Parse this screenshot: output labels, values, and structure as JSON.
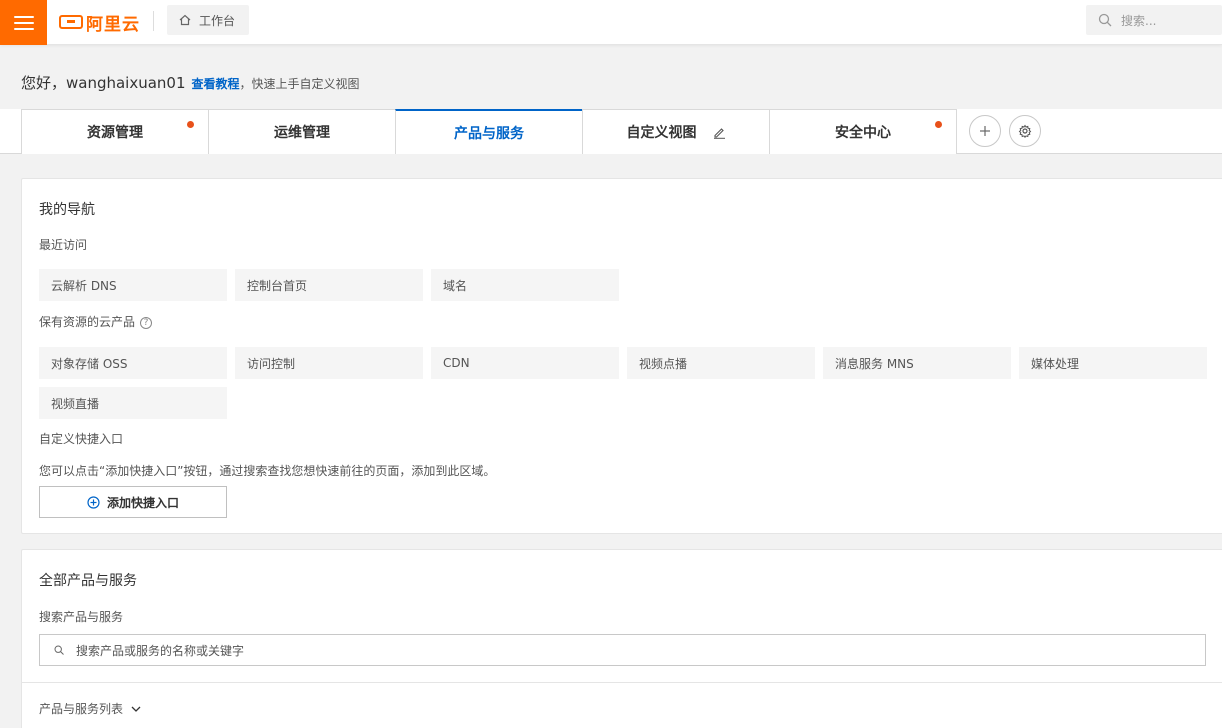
{
  "topbar": {
    "logo_text": "阿里云",
    "workbench_label": "工作台",
    "search_placeholder": "搜索..."
  },
  "greeting": {
    "hello": "您好，wanghaixuan01",
    "tutorial_link": "查看教程",
    "tip": "，快速上手自定义视图"
  },
  "tabs": [
    {
      "label": "资源管理",
      "dot": true
    },
    {
      "label": "运维管理",
      "dot": false
    },
    {
      "label": "产品与服务",
      "active": true
    },
    {
      "label": "自定义视图",
      "editable": true
    },
    {
      "label": "安全中心",
      "dot": true
    }
  ],
  "nav_card": {
    "title": "我的导航",
    "recent_title": "最近访问",
    "recent": [
      "云解析 DNS",
      "控制台首页",
      "域名"
    ],
    "owned_title": "保有资源的云产品",
    "owned": [
      "对象存储 OSS",
      "访问控制",
      "CDN",
      "视频点播",
      "消息服务 MNS",
      "媒体处理",
      "视频直播"
    ],
    "custom_title": "自定义快捷入口",
    "custom_desc": "您可以点击“添加快捷入口”按钮，通过搜索查找您想快速前往的页面，添加到此区域。",
    "add_button": "添加快捷入口"
  },
  "products_card": {
    "title": "全部产品与服务",
    "search_label": "搜索产品与服务",
    "search_placeholder": "搜索产品或服务的名称或关键字",
    "list_label": "产品与服务列表"
  },
  "colors": {
    "brand": "#ff6a00",
    "accent": "#0064c8",
    "dot": "#e8511a"
  }
}
